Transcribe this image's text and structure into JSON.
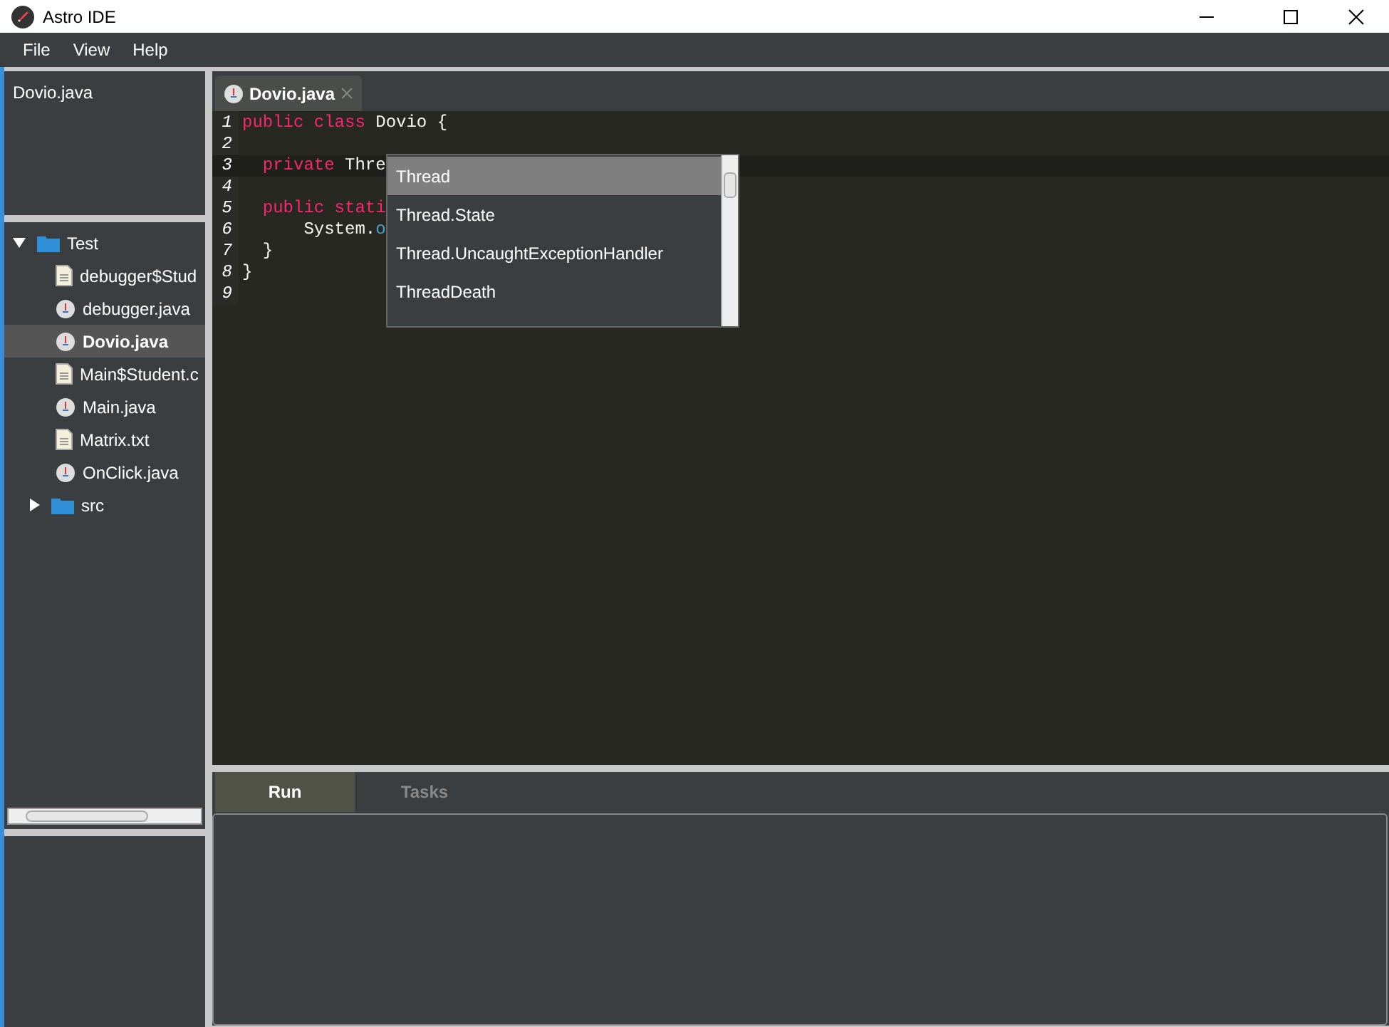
{
  "window": {
    "title": "Astro IDE"
  },
  "menu": [
    "File",
    "View",
    "Help"
  ],
  "open_files": [
    "Dovio.java"
  ],
  "tree": [
    {
      "label": "Test",
      "kind": "folder",
      "expanded": true,
      "selected": false,
      "children": [
        {
          "label": "debugger$Stud",
          "kind": "text",
          "selected": false
        },
        {
          "label": "debugger.java",
          "kind": "java",
          "selected": false
        },
        {
          "label": "Dovio.java",
          "kind": "java",
          "selected": true
        },
        {
          "label": "Main$Student.c",
          "kind": "text",
          "selected": false
        },
        {
          "label": "Main.java",
          "kind": "java",
          "selected": false
        },
        {
          "label": "Matrix.txt",
          "kind": "text",
          "selected": false
        },
        {
          "label": "OnClick.java",
          "kind": "java",
          "selected": false
        }
      ]
    },
    {
      "label": "src",
      "kind": "folder",
      "expanded": false,
      "selected": false
    }
  ],
  "editor_tabs": [
    {
      "label": "Dovio.java",
      "selected": true
    }
  ],
  "code": [
    {
      "number": "1",
      "current": false,
      "tokens": [
        {
          "text": "public class",
          "kind": "keyword"
        },
        {
          "text": " Dovio {",
          "kind": "plain"
        }
      ]
    },
    {
      "number": "2",
      "current": false
    },
    {
      "number": "3",
      "current": true,
      "tokens": [
        {
          "text": "  private",
          "kind": "keyword"
        },
        {
          "text": " Thre",
          "kind": "plain"
        }
      ]
    },
    {
      "number": "4",
      "current": false
    },
    {
      "number": "5",
      "current": false,
      "tokens": [
        {
          "text": "  public stati",
          "kind": "keyword"
        }
      ]
    },
    {
      "number": "6",
      "current": false,
      "tokens": [
        {
          "text": "      System.",
          "kind": "plain"
        },
        {
          "text": "o",
          "kind": "field"
        }
      ]
    },
    {
      "number": "7",
      "current": false,
      "tokens": [
        {
          "text": "  }",
          "kind": "plain"
        }
      ]
    },
    {
      "number": "8",
      "current": false,
      "tokens": [
        {
          "text": "}",
          "kind": "plain"
        }
      ]
    },
    {
      "number": "9",
      "current": false
    }
  ],
  "completion": [
    {
      "label": "Thread",
      "selected": true
    },
    {
      "label": "Thread.State",
      "selected": false
    },
    {
      "label": "Thread.UncaughtExceptionHandler",
      "selected": false
    },
    {
      "label": "ThreadDeath",
      "selected": false
    }
  ],
  "bottom_tabs": [
    {
      "label": "Run",
      "selected": true
    },
    {
      "label": "Tasks",
      "selected": false
    }
  ]
}
